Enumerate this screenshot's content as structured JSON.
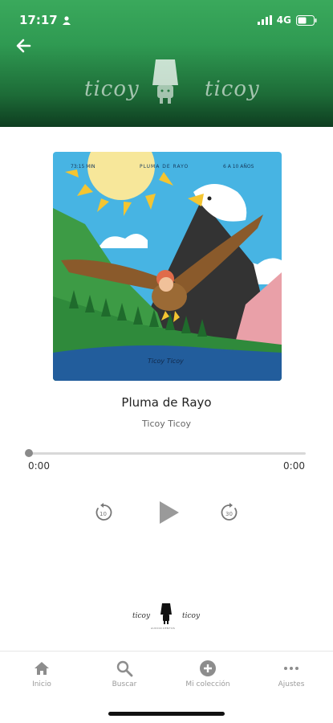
{
  "status_bar": {
    "time": "17:17",
    "network": "4G"
  },
  "header": {
    "brand_left": "ticoy",
    "brand_right": "ticoy"
  },
  "album": {
    "cover_texts": {
      "left": "73:15 MIN",
      "center": "PLUMA DE RAYO",
      "right": "6 A 10 AÑOS",
      "bottom": "Ticoy Ticoy"
    }
  },
  "track": {
    "title": "Pluma de Rayo",
    "artist": "Ticoy Ticoy",
    "elapsed": "0:00",
    "duration": "0:00",
    "progress": 0
  },
  "controls": {
    "rewind_seconds": "10",
    "forward_seconds": "30"
  },
  "footer": {
    "brand_left": "ticoy",
    "brand_right": "ticoy",
    "tagline": "AUDIOCUENTOS"
  },
  "tabs": [
    {
      "label": "Inicio",
      "icon": "home-icon"
    },
    {
      "label": "Buscar",
      "icon": "search-icon"
    },
    {
      "label": "Mi colección",
      "icon": "add-circle-icon"
    },
    {
      "label": "Ajustes",
      "icon": "more-icon"
    }
  ],
  "colors": {
    "header_green": "#2f9a52",
    "accent_gray": "#8a8a8a"
  }
}
